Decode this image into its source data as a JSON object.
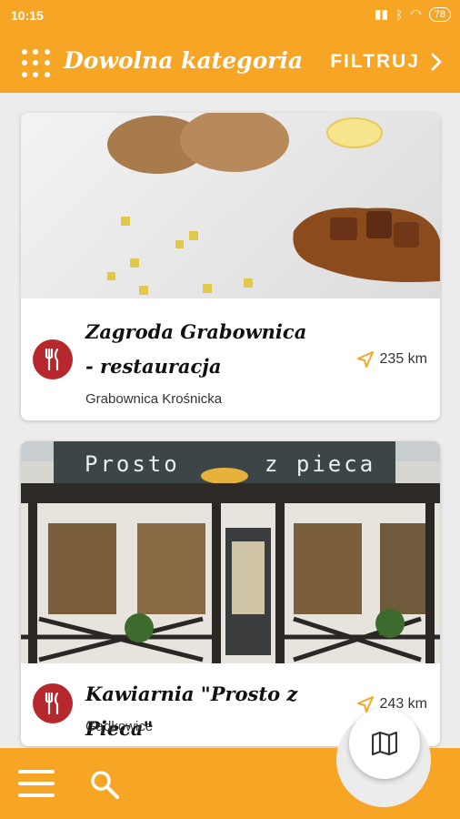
{
  "status": {
    "time": "10:15",
    "battery": "78"
  },
  "header": {
    "title": "Dowolna kategoria",
    "filter_label": "FILTRUJ"
  },
  "places": [
    {
      "name": "Zagroda Grabownica - restauracja",
      "location": "Grabownica Krośnicka",
      "distance": "235 km",
      "category_icon": "fork-knife-icon"
    },
    {
      "name": "Kawiarnia \"Prosto z Pieca\"",
      "location": "Gądkowice",
      "distance": "243 km",
      "category_icon": "fork-knife-icon",
      "sign_text_left": "Prosto",
      "sign_text_right": "z pieca"
    }
  ],
  "colors": {
    "accent": "#f7a524",
    "category": "#b7282e"
  }
}
